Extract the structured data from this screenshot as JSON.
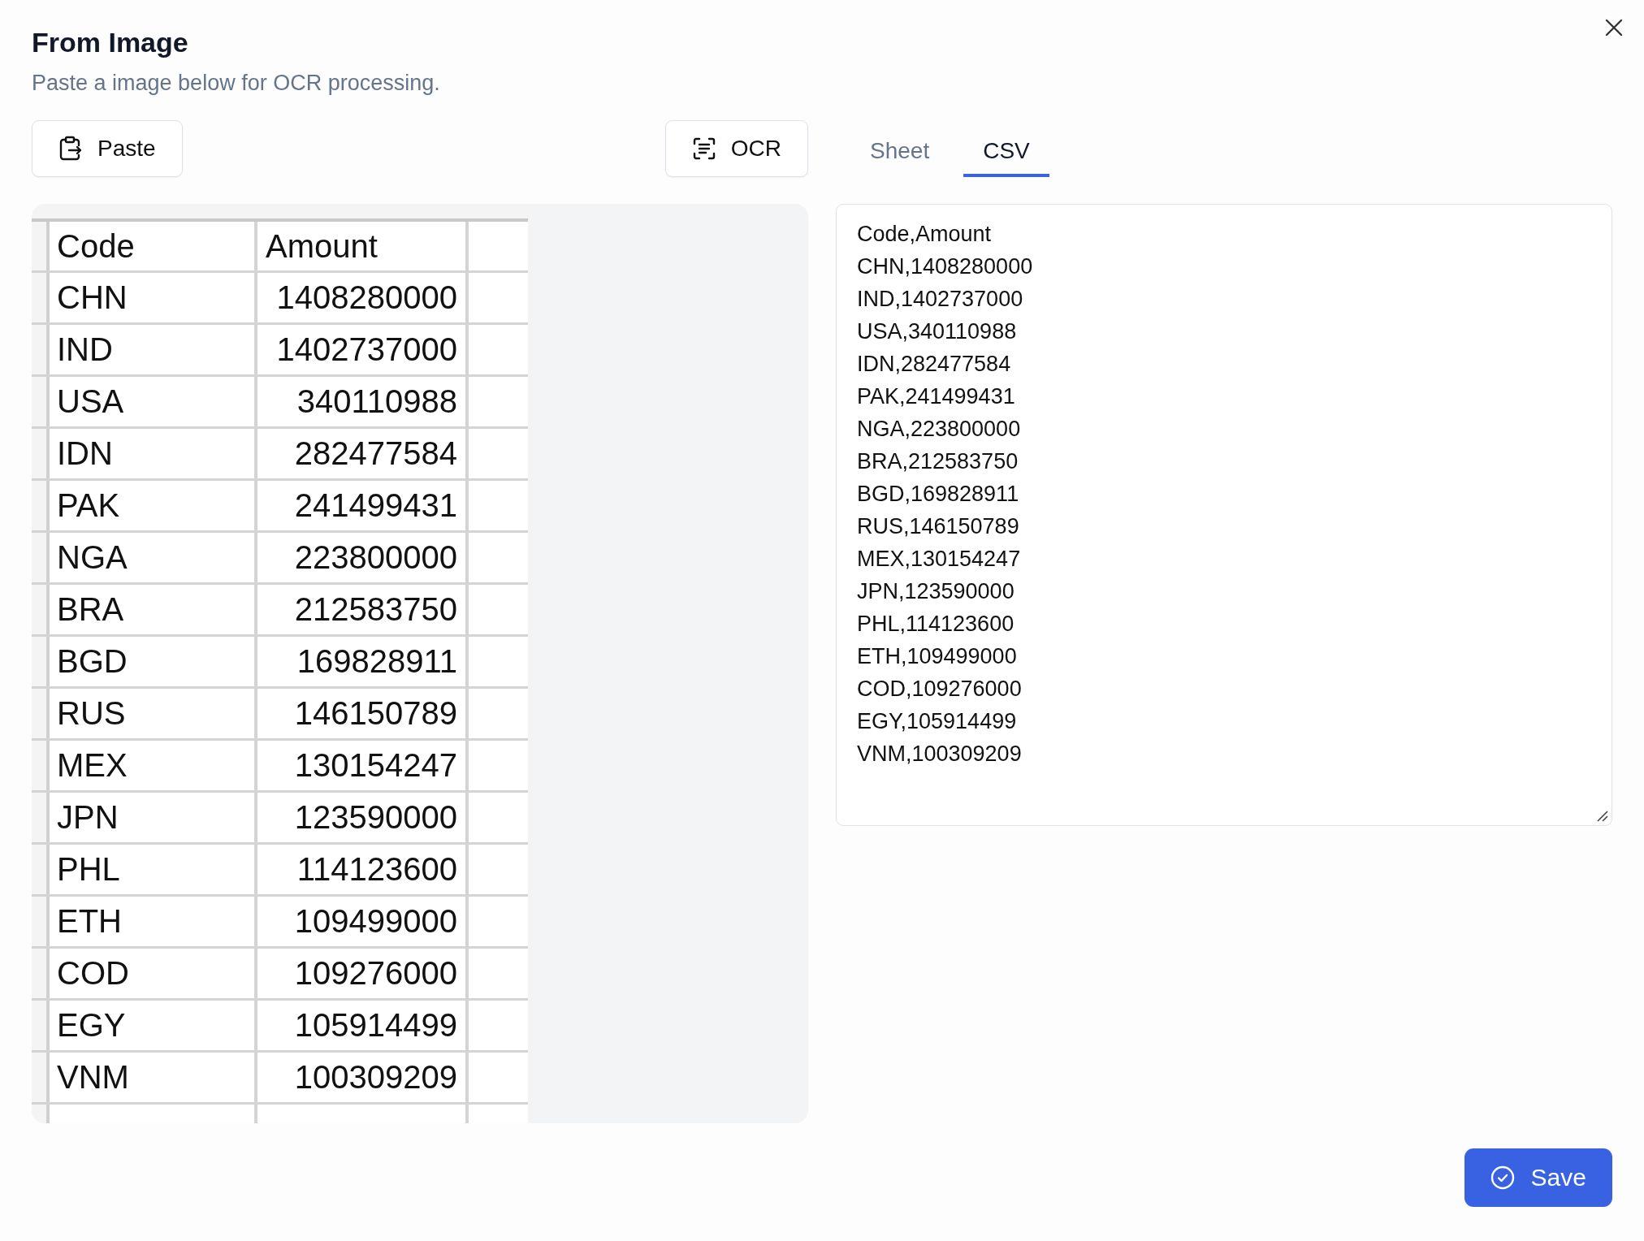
{
  "dialog": {
    "title": "From Image",
    "subtitle": "Paste a image below for OCR processing."
  },
  "paste_button": {
    "label": "Paste"
  },
  "ocr_button": {
    "label": "OCR"
  },
  "tabs": [
    {
      "label": "Sheet",
      "selected": false
    },
    {
      "label": "CSV",
      "selected": true
    }
  ],
  "pasted_image": {
    "columns": [
      "Code",
      "Amount"
    ],
    "rows": [
      [
        "CHN",
        "1408280000"
      ],
      [
        "IND",
        "1402737000"
      ],
      [
        "USA",
        "340110988"
      ],
      [
        "IDN",
        "282477584"
      ],
      [
        "PAK",
        "241499431"
      ],
      [
        "NGA",
        "223800000"
      ],
      [
        "BRA",
        "212583750"
      ],
      [
        "BGD",
        "169828911"
      ],
      [
        "RUS",
        "146150789"
      ],
      [
        "MEX",
        "130154247"
      ],
      [
        "JPN",
        "123590000"
      ],
      [
        "PHL",
        "114123600"
      ],
      [
        "ETH",
        "109499000"
      ],
      [
        "COD",
        "109276000"
      ],
      [
        "EGY",
        "105914499"
      ],
      [
        "VNM",
        "100309209"
      ]
    ]
  },
  "csv_field": {
    "value": "Code,Amount\nCHN,1408280000\nIND,1402737000\nUSA,340110988\nIDN,282477584\nPAK,241499431\nNGA,223800000\nBRA,212583750\nBGD,169828911\nRUS,146150789\nMEX,130154247\nJPN,123590000\nPHL,114123600\nETH,109499000\nCOD,109276000\nEGY,105914499\nVNM,100309209"
  },
  "save_button": {
    "label": "Save"
  }
}
